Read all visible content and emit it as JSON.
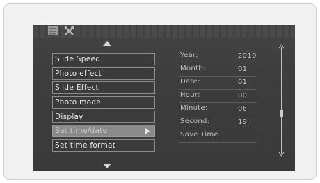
{
  "top_icons": [
    "list-icon",
    "tools-icon"
  ],
  "menu": {
    "items": [
      {
        "label": "Slide Speed"
      },
      {
        "label": "Photo effect"
      },
      {
        "label": "Slide Effect"
      },
      {
        "label": "Photo mode"
      },
      {
        "label": "Display"
      },
      {
        "label": "Set time/date"
      },
      {
        "label": "Set time format"
      }
    ],
    "selected": "Set time/date"
  },
  "datetime": {
    "year_label": "Year:",
    "year_value": "2010",
    "month_label": "Month:",
    "month_value": "01",
    "date_label": "Date:",
    "date_value": "01",
    "hour_label": "Hour:",
    "hour_value": "00",
    "minute_label": "Minute:",
    "minute_value": "06",
    "second_label": "Second:",
    "second_value": "19",
    "save_label": "Save Time"
  },
  "colors": {
    "screen_bg": "#3d3d3d",
    "selected_bg": "#8a8a8a",
    "border": "#8a8a8a",
    "text": "#e6e6e6"
  }
}
